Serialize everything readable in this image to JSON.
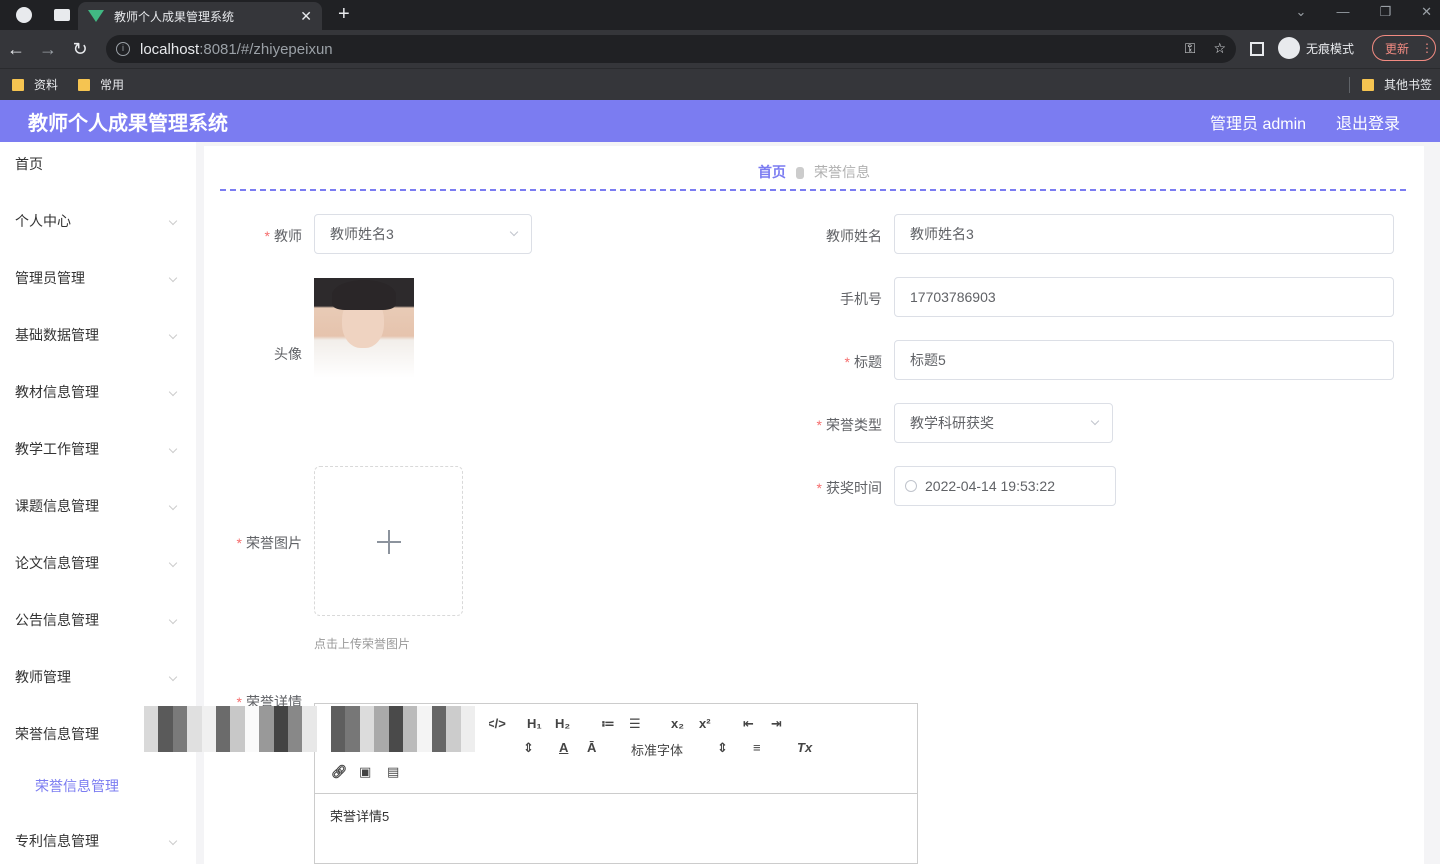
{
  "browser": {
    "tab_title": "教师个人成果管理系统",
    "url_host": "localhost",
    "url_rest": ":8081/#/zhiyepeixun",
    "incognito_label": "无痕模式",
    "update_label": "更新",
    "bookmarks": [
      "资料",
      "常用"
    ],
    "other_bookmarks": "其他书签"
  },
  "header": {
    "title": "教师个人成果管理系统",
    "user": "管理员 admin",
    "logout": "退出登录"
  },
  "sidebar": {
    "items": [
      "首页",
      "个人中心",
      "管理员管理",
      "基础数据管理",
      "教材信息管理",
      "教学工作管理",
      "课题信息管理",
      "论文信息管理",
      "公告信息管理",
      "教师管理",
      "荣誉信息管理",
      "专利信息管理"
    ],
    "active_sub": "荣誉信息管理"
  },
  "breadcrumb": {
    "home": "首页",
    "current": "荣誉信息"
  },
  "form": {
    "teacher_label": "教师",
    "teacher_value": "教师姓名3",
    "teacher_name_label": "教师姓名",
    "teacher_name_value": "教师姓名3",
    "avatar_label": "头像",
    "phone_label": "手机号",
    "phone_value": "17703786903",
    "title_label": "标题",
    "title_value": "标题5",
    "honor_type_label": "荣誉类型",
    "honor_type_value": "教学科研获奖",
    "award_time_label": "获奖时间",
    "award_time_value": "2022-04-14 19:53:22",
    "honor_image_label": "荣誉图片",
    "upload_tip": "点击上传荣誉图片",
    "detail_label": "荣誉详情",
    "detail_content": "荣誉详情5"
  },
  "editor": {
    "tools": [
      "</>",
      "H₁",
      "H₂",
      "≔",
      "☰",
      "x₂",
      "x²",
      "⇤",
      "⇥",
      "A",
      "Ā",
      "≡",
      "Tx"
    ],
    "font_select": "标准字体"
  }
}
